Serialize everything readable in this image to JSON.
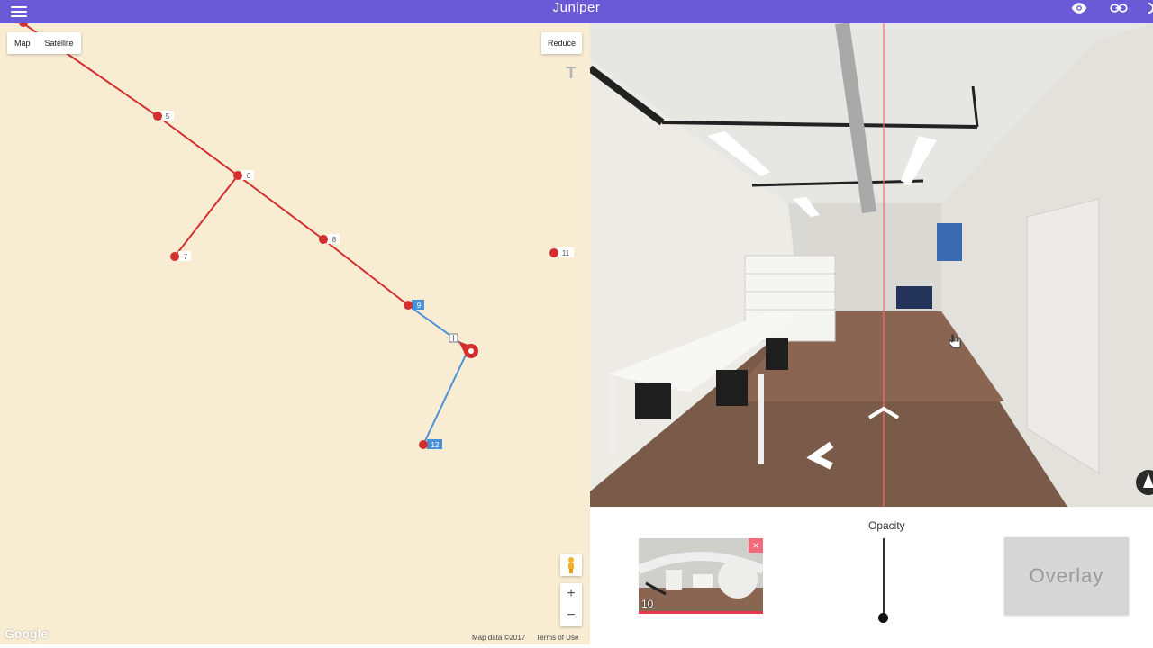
{
  "app": {
    "title": "Juniper"
  },
  "map": {
    "type_buttons": [
      "Map",
      "Satellite"
    ],
    "reduce_label": "Reduce",
    "text_tool": "T",
    "google_logo": "Google",
    "footer": {
      "data": "Map data ©2017",
      "terms": "Terms of Use"
    },
    "zoom_in": "+",
    "zoom_out": "−",
    "nodes": [
      "5",
      "6",
      "7",
      "8",
      "9",
      "11",
      "12"
    ],
    "colors": {
      "red_path": "#d32f2f",
      "blue_path": "#4a90d9",
      "background": "#f8edd3"
    }
  },
  "panel": {
    "thumb_number": "10",
    "thumb_close": "×",
    "opacity_label": "Opacity",
    "opacity_value": 0,
    "overlay_label": "Overlay"
  },
  "colors": {
    "topbar": "#6a5ad6",
    "accent_red": "#e53950"
  }
}
